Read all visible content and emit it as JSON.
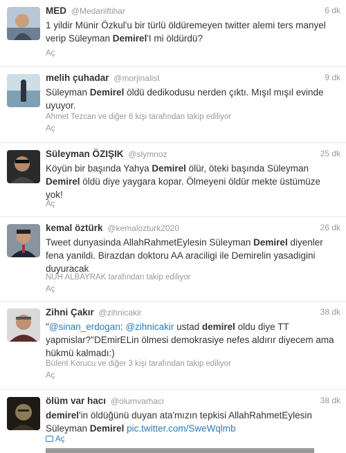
{
  "expand_label": "Aç",
  "tweets": [
    {
      "name": "MED",
      "handle": "@Medariiftihar",
      "time": "6 dk",
      "segments": [
        {
          "t": "1 yildir Münir Özkul'u bir türlü öldüremeyen twitter alemi ters manyel verip Süleyman "
        },
        {
          "t": "Demirel",
          "b": true
        },
        {
          "t": "'I mi öldürdü?"
        }
      ],
      "context": ""
    },
    {
      "name": "melih çuhadar",
      "handle": "@morjinalist",
      "time": "9 dk",
      "segments": [
        {
          "t": "Süleyman "
        },
        {
          "t": "Demirel",
          "b": true
        },
        {
          "t": " öldü dedikodusu nerden çıktı. Mışıl mışıl evinde uyuyor."
        }
      ],
      "context": "Ahmet Tezcan ve diğer 6 kişi tarafından takip ediliyor"
    },
    {
      "name": "Süleyman ÖZIŞIK",
      "handle": "@slymnoz",
      "time": "25 dk",
      "segments": [
        {
          "t": "Köyün bir başında Yahya "
        },
        {
          "t": "Demirel",
          "b": true
        },
        {
          "t": " ölür, öteki başında Süleyman "
        },
        {
          "t": "Demirel",
          "b": true
        },
        {
          "t": " öldü diye yaygara kopar. Ölmeyeni öldür mekte üstümüze yok!"
        }
      ],
      "context": ""
    },
    {
      "name": "kemal öztürk",
      "handle": "@kemalozturk2020",
      "time": "26 dk",
      "segments": [
        {
          "t": "Tweet dunyasinda AllahRahmetEylesin Süleyman "
        },
        {
          "t": "Demirel",
          "b": true
        },
        {
          "t": " diyenler fena yanildi. Birazdan doktoru AA araciligi ile Demirelin yasadigini duyuracak"
        }
      ],
      "context": "NUH ALBAYRAK tarafından takip ediliyor"
    },
    {
      "name": "Zihni Çakır",
      "handle": "@zihnicakir",
      "time": "38 dk",
      "segments": [
        {
          "t": "\""
        },
        {
          "t": "@sinan_erdogan",
          "link": true
        },
        {
          "t": ": "
        },
        {
          "t": "@zihnicakir",
          "link": true
        },
        {
          "t": " ustad "
        },
        {
          "t": "demirel",
          "b": true
        },
        {
          "t": " oldu diye TT yapmislar?\"DEmirELin ölmesi demokrasiye nefes aldırır diyecem ama hükmü kalmadı:)"
        }
      ],
      "context": "Bülent Korucu ve diğer 3 kişi tarafından takip ediliyor"
    },
    {
      "name": "ölüm var hacı",
      "handle": "@olumvarhaci",
      "time": "38 dk",
      "segments": [
        {
          "t": "demirel",
          "b": true
        },
        {
          "t": "'in öldüğünü duyan ata'mızın tepkisi AllahRahmetEylesin Süleyman "
        },
        {
          "t": "Demirel",
          "b": true
        },
        {
          "t": " "
        },
        {
          "t": "pic.twitter.com/SweWqlmb",
          "link": true
        }
      ],
      "context": ""
    }
  ]
}
